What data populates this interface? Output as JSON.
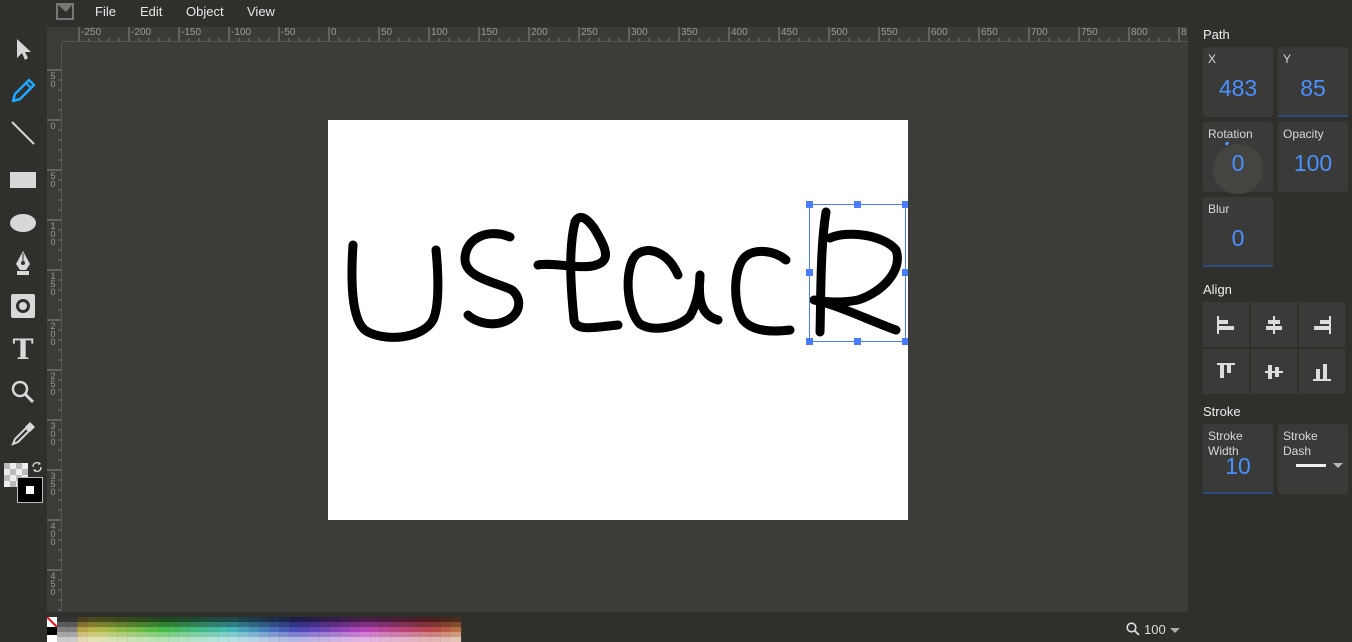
{
  "menu": {
    "items": [
      "File",
      "Edit",
      "Object",
      "View"
    ]
  },
  "tools": [
    {
      "name": "select-tool",
      "icon": "cursor-arrow-icon"
    },
    {
      "name": "pencil-tool",
      "icon": "pencil-icon",
      "active": true
    },
    {
      "name": "line-tool",
      "icon": "line-icon"
    },
    {
      "name": "rectangle-tool",
      "icon": "rectangle-icon"
    },
    {
      "name": "ellipse-tool",
      "icon": "ellipse-icon"
    },
    {
      "name": "pen-tool",
      "icon": "pen-nib-icon"
    },
    {
      "name": "shapes-tool",
      "icon": "shapes-icon"
    },
    {
      "name": "text-tool",
      "icon": "text-icon"
    },
    {
      "name": "zoom-tool",
      "icon": "magnifier-icon"
    },
    {
      "name": "eyedropper-tool",
      "icon": "eyedropper-icon"
    }
  ],
  "ruler": {
    "top_labels": [
      "-250",
      "-200",
      "-150",
      "-100",
      "-50",
      "0",
      "50",
      "100",
      "150",
      "200",
      "250",
      "300",
      "350",
      "400",
      "450",
      "500",
      "550",
      "600",
      "650",
      "700",
      "750",
      "800",
      "8"
    ],
    "left_labels": [
      "50",
      "0",
      "50",
      "100",
      "150",
      "200",
      "250",
      "300",
      "350",
      "400",
      "450"
    ]
  },
  "panel": {
    "path_title": "Path",
    "x_label": "X",
    "x_value": "483",
    "y_label": "Y",
    "y_value": "85",
    "rotation_label": "Rotation",
    "rotation_value": "0",
    "opacity_label": "Opacity",
    "opacity_value": "100",
    "blur_label": "Blur",
    "blur_value": "0",
    "align_title": "Align",
    "stroke_title": "Stroke",
    "stroke_width_label": "Stroke Width",
    "stroke_width_value": "10",
    "stroke_dash_label": "Stroke Dash"
  },
  "zoom": {
    "value": "100"
  },
  "colors": {
    "accent": "#4a90ff",
    "active_tool": "#1ea7ff",
    "selection": "#4a7cff",
    "stroke": "#000000"
  }
}
